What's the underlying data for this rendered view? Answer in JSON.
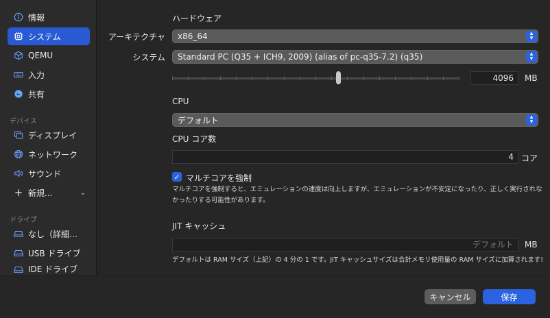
{
  "sidebar": {
    "items": [
      {
        "label": "情報",
        "icon": "info-icon"
      },
      {
        "label": "システム",
        "icon": "chip-icon",
        "selected": true
      },
      {
        "label": "QEMU",
        "icon": "cube-icon"
      },
      {
        "label": "入力",
        "icon": "keyboard-icon"
      },
      {
        "label": "共有",
        "icon": "share-icon"
      }
    ],
    "devices_title": "デバイス",
    "devices": [
      {
        "label": "ディスプレイ",
        "icon": "display-icon"
      },
      {
        "label": "ネットワーク",
        "icon": "globe-icon"
      },
      {
        "label": "サウンド",
        "icon": "speaker-icon"
      }
    ],
    "new_label": "新規...",
    "drives_title": "ドライブ",
    "drives": [
      {
        "label": "なし（詳細…",
        "icon": "drive-icon"
      },
      {
        "label": "USB ドライブ",
        "icon": "drive-icon"
      },
      {
        "label": "IDE ドライブ",
        "icon": "drive-icon"
      }
    ]
  },
  "hardware": {
    "title": "ハードウェア",
    "architecture_label": "アーキテクチャ",
    "architecture_value": "x86_64",
    "system_label": "システム",
    "system_value": "Standard PC (Q35 + ICH9, 2009) (alias of pc-q35-7.2) (q35)",
    "memory_value": "4096",
    "memory_unit": "MB",
    "memory_slider_fraction": 0.58
  },
  "cpu": {
    "title": "CPU",
    "value": "デフォルト",
    "cores_title": "CPU コア数",
    "cores_value": "4",
    "cores_unit": "コア",
    "force_multicore_label": "マルチコアを強制",
    "force_multicore_checked": true,
    "description_line1": "マルチコアを強制すると、エミュレーションの速度は向上しますが、エミュレーションが不安定になったり、正しく実行されな",
    "description_line2": "かったりする可能性があります。"
  },
  "jit": {
    "title": "JIT キャッシュ",
    "placeholder": "デフォルト",
    "unit": "MB",
    "description": "デフォルトは RAM サイズ（上記）の 4 分の 1 です。JIT キャッシュサイズは合計メモリ使用量の RAM サイズに加算されます!"
  },
  "footer": {
    "cancel_label": "キャンセル",
    "save_label": "保存"
  }
}
